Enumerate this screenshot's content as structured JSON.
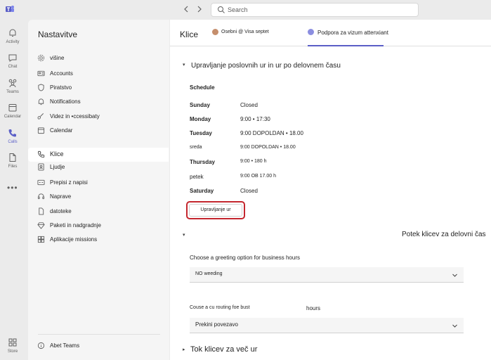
{
  "topbar": {
    "search_placeholder": "Search",
    "logo_icon": "teams-logo-icon",
    "back_icon": "chevron-left-icon",
    "forward_icon": "chevron-right-icon"
  },
  "rail": {
    "items": [
      {
        "label": "Activity",
        "icon": "bell-icon"
      },
      {
        "label": "Chat",
        "icon": "chat-icon"
      },
      {
        "label": "Teams",
        "icon": "teams-icon"
      },
      {
        "label": "Calendar",
        "icon": "calendar-icon"
      },
      {
        "label": "Calls",
        "icon": "phone-icon"
      },
      {
        "label": "Files",
        "icon": "file-icon"
      },
      {
        "label": "Store",
        "icon": "store-icon"
      }
    ],
    "more": "•••"
  },
  "pane": {
    "title": "Nastavitve",
    "items": [
      {
        "label": "višine",
        "icon": "gear-icon"
      },
      {
        "label": "Accounts",
        "icon": "id-card-icon"
      },
      {
        "label": "Piratstvo",
        "icon": "shield-icon"
      },
      {
        "label": "Notifications",
        "icon": "bell-icon"
      },
      {
        "label": "Videz in •ccessibaty",
        "icon": "brush-icon"
      },
      {
        "label": "Calendar",
        "icon": "calendar-icon"
      },
      {
        "label": "Klice",
        "icon": "phone-icon"
      },
      {
        "label": "Ljudje",
        "icon": "contacts-icon"
      },
      {
        "label": "Prepisi z napisi",
        "icon": "captions-icon"
      },
      {
        "label": "Naprave",
        "icon": "headset-icon"
      },
      {
        "label": "datoteke",
        "icon": "file-icon"
      },
      {
        "label": "Paketi in nadgradnje",
        "icon": "diamond-icon"
      },
      {
        "label": "Aplikacije missions",
        "icon": "apps-icon"
      }
    ],
    "about": {
      "label": "Abet Teams",
      "icon": "info-icon"
    }
  },
  "main": {
    "title": "Klice",
    "tab_personal": "Osebni @ Visa septet",
    "tab_delegate": "Podpora za vizum attenxiant",
    "section_hours": "Upravljanje poslovnih ur in ur po delovnem času",
    "schedule_label": "Schedule",
    "schedule": [
      {
        "day": "Sunday",
        "hours": "Closed"
      },
      {
        "day": "Monday",
        "hours": "9:00 • 17:30"
      },
      {
        "day": "Tuesday",
        "hours": "9:00  DOPOLDAN • 18.00"
      },
      {
        "day": "sreda",
        "hours": "9:00  DOPOLDAN • 18.00"
      },
      {
        "day": "Thursday",
        "hours": "9:00 • 180 h"
      },
      {
        "day": "petek",
        "hours": "9:00  OB 17.00 h"
      },
      {
        "day": "Saturday",
        "hours": "Closed"
      }
    ],
    "manage_button": "Upravljanje ur",
    "section_routing": "Potek klicev za delovni čas",
    "greeting_label": "Choose a greeting option for business hours",
    "greeting_value": "NO weeding",
    "routing_label": "Couse a cu routing foe bust",
    "routing_hours": "hours",
    "routing_value": "Prekini povezavo",
    "section_after": "Tok klicev za več ur"
  },
  "colors": {
    "accent": "#5b5fc7",
    "highlight": "#c4262e"
  }
}
